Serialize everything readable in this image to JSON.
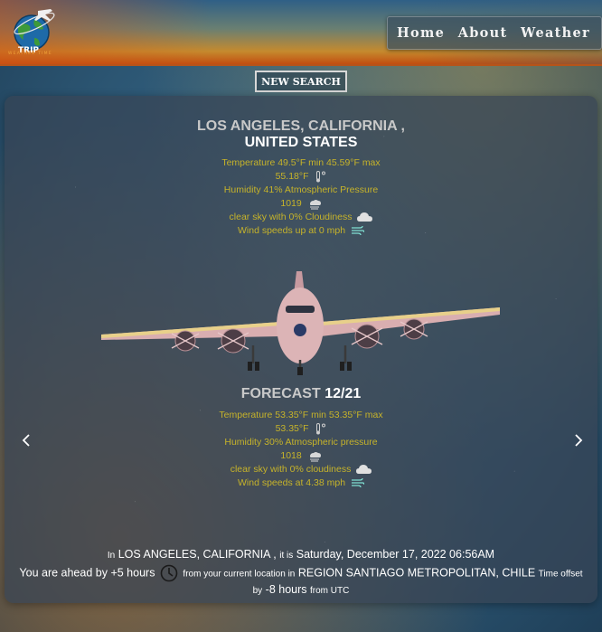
{
  "header": {
    "logo_text": "TRIP",
    "logo_subtext": "WEATHER TIME",
    "nav": {
      "home": "Home",
      "about": "About",
      "weather": "Weather"
    }
  },
  "new_search_label": "NEW SEARCH",
  "current": {
    "city": "LOS ANGELES, CALIFORNIA ,",
    "country": "UNITED STATES",
    "line1": "Temperature 49.5°F min 45.59°F max",
    "line2": "55.18°F",
    "line3": "Humidity 41% Atmospheric Pressure",
    "line4": "1019",
    "line5": "clear sky with 0% Cloudiness",
    "line6": "Wind speeds up at 0 mph"
  },
  "forecast": {
    "title": "FORECAST",
    "date": "12/21",
    "line1": "Temperature 53.35°F min 53.35°F max",
    "line2": "53.35°F",
    "line3": "Humidity 30% Atmospheric pressure",
    "line4": "1018",
    "line5": "clear sky with 0% cloudiness",
    "line6": "Wind speeds at 4.38 mph"
  },
  "footer": {
    "in": "In",
    "city": "LOS ANGELES, CALIFORNIA ,",
    "it_is": "it is",
    "datetime": "Saturday, December 17, 2022 06:56AM",
    "ahead_prefix": "You are ahead by",
    "ahead_value": "+5 hours",
    "from_current": "from your current location in",
    "current_location": "REGION SANTIAGO METROPOLITAN, CHILE",
    "offset_label": "Time offset",
    "by": "by",
    "offset_value": "-8 hours",
    "from_utc": "from UTC"
  },
  "icons": {
    "thermometer": "thermometer-icon",
    "pressure": "pressure-icon",
    "cloud": "cloud-icon",
    "wind": "wind-icon",
    "clock": "clock-icon",
    "prev": "chevron-left-icon",
    "next": "chevron-right-icon"
  },
  "colors": {
    "weather_text": "#c6b32a",
    "accent_wind": "#7fe0d2"
  }
}
